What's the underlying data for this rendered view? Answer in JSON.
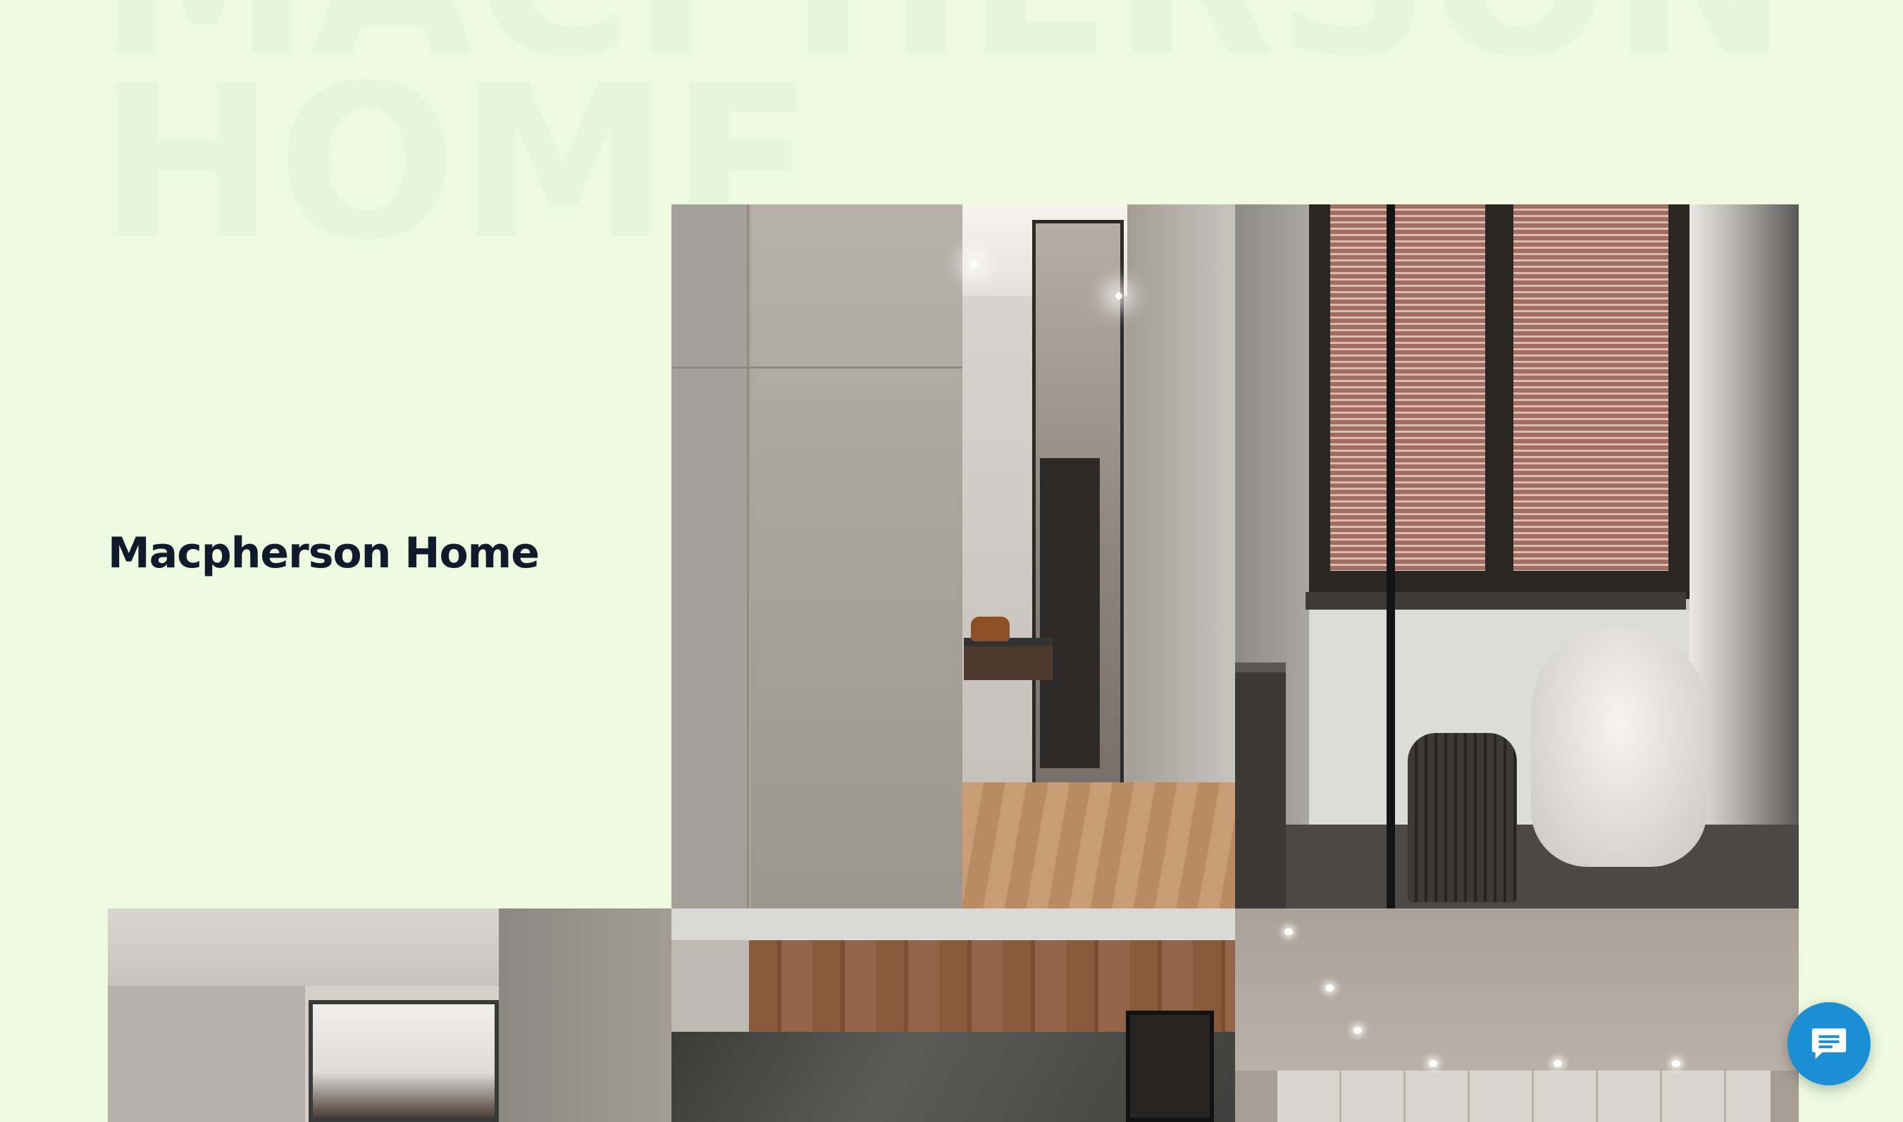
{
  "background_title": "MACPHERSON\nHOME",
  "project": {
    "title": "Macpherson Home"
  },
  "gallery": {
    "images": [
      {
        "name": "hallway-mirror-photo"
      },
      {
        "name": "window-armchair-photo"
      },
      {
        "name": "living-room-photo"
      },
      {
        "name": "kitchen-marble-photo"
      },
      {
        "name": "cabinet-ceiling-photo"
      }
    ]
  },
  "chat": {
    "icon": "chat-bubble-icon",
    "color": "#1a8fd5"
  },
  "colors": {
    "page_background": "#edfadf",
    "title_text": "#0f1a2c"
  }
}
